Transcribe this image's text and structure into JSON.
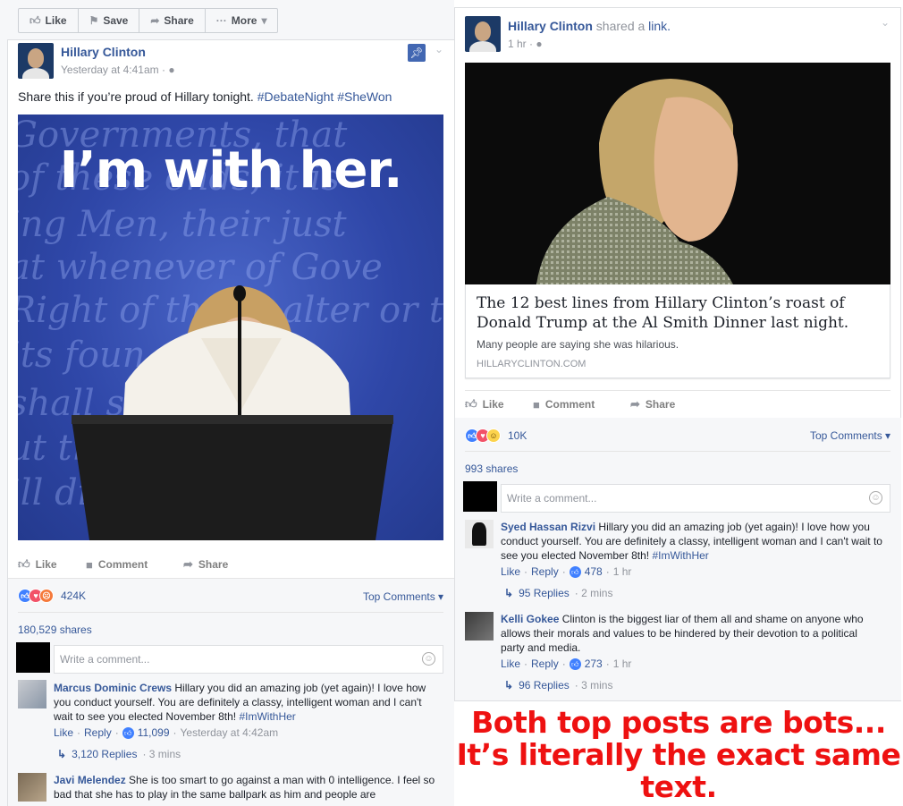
{
  "topbar": {
    "like": "Like",
    "save": "Save",
    "share": "Share",
    "more": "More"
  },
  "left_post": {
    "author": "Hillary Clinton",
    "time": "Yesterday at 4:41am",
    "text": "Share this if you’re proud of Hillary tonight. ",
    "tag1": "#DebateNight",
    "tag2": "#SheWon",
    "photo_banner": "I’m with her.",
    "actions": {
      "like": "Like",
      "comment": "Comment",
      "share": "Share"
    },
    "reaction_count": "424K",
    "top_comments": "Top Comments",
    "shares": "180,529 shares",
    "comment_placeholder": "Write a comment...",
    "comments": [
      {
        "name": "Marcus Dominic Crews",
        "text": "Hillary you did an amazing job (yet again)! I love how you conduct yourself. You are definitely a classy, intelligent woman and I can't wait to see you elected November 8th! ",
        "hashtag": "#ImWithHer",
        "like": "Like",
        "reply": "Reply",
        "likes": "11,099",
        "time": "Yesterday at 4:42am",
        "replies": "3,120 Replies",
        "replies_time": "3 mins"
      },
      {
        "name": "Javi Melendez",
        "text": "She is too smart to go against a man with 0 intelligence. I feel so bad that she has to play in the same ballpark as him and people are"
      }
    ]
  },
  "right_post": {
    "author": "Hillary Clinton",
    "shared": "shared a",
    "link_word": "link.",
    "time": "1 hr",
    "link_title": "The 12 best lines from Hillary Clinton’s roast of Donald Trump at the Al Smith Dinner last night.",
    "link_desc": "Many people are saying she was hilarious.",
    "link_domain": "HILLARYCLINTON.COM",
    "actions": {
      "like": "Like",
      "comment": "Comment",
      "share": "Share"
    },
    "reaction_count": "10K",
    "top_comments": "Top Comments",
    "shares": "993 shares",
    "comment_placeholder": "Write a comment...",
    "comments": [
      {
        "name": "Syed Hassan Rizvi",
        "text": "Hillary you did an amazing job (yet again)! I love how you conduct yourself. You are definitely a classy, intelligent woman and I can't wait to see you elected November 8th! ",
        "hashtag": "#ImWithHer",
        "like": "Like",
        "reply": "Reply",
        "likes": "478",
        "time": "1 hr",
        "replies": "95 Replies",
        "replies_time": "2 mins"
      },
      {
        "name": "Kelli Gokee",
        "text": "Clinton is the biggest liar of them all and shame on anyone who allows their morals and values to be hindered by their devotion to a political party and media.",
        "like": "Like",
        "reply": "Reply",
        "likes": "273",
        "time": "1 hr",
        "replies": "96 Replies",
        "replies_time": "3 mins"
      }
    ]
  },
  "caption": {
    "line1": "Both top posts are bots...",
    "line2": "It’s literally the exact same",
    "line3": "text."
  },
  "colors": {
    "fb_blue": "#365899",
    "caption_red": "#ee1111",
    "like_blue": "#4080ff",
    "love_red": "#f25268",
    "angry_orange": "#f5793b",
    "haha_yellow": "#fcd34d"
  }
}
